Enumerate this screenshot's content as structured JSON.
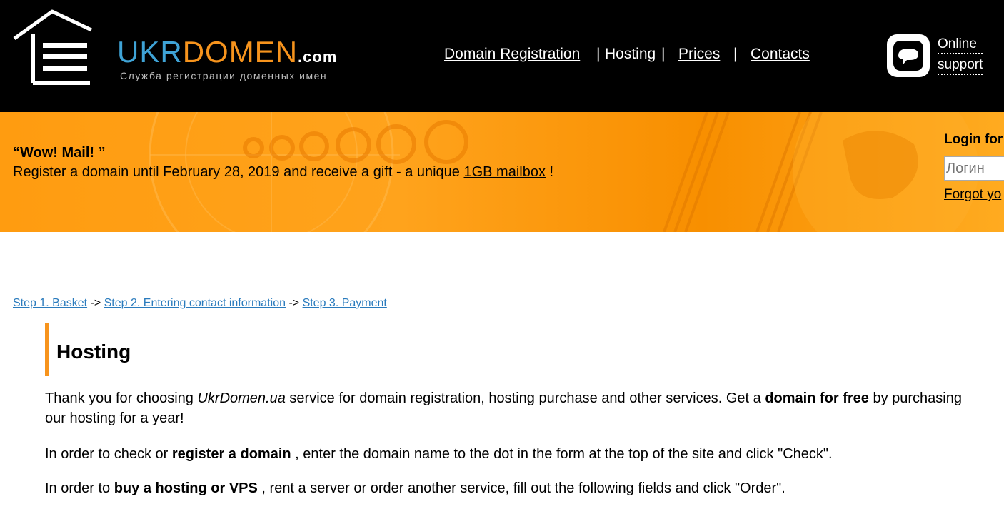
{
  "header": {
    "logo": {
      "ukr": "UKR",
      "domen": "DOMEN",
      "com": ".com",
      "tagline": "Служба регистрации доменных имен"
    },
    "nav": {
      "domain_registration": "Domain Registration",
      "sep1": "|",
      "hosting": "Hosting",
      "sep2": "|",
      "prices": "Prices",
      "sep3": "|",
      "contacts": "Contacts"
    },
    "support": {
      "line1": "Online",
      "line2": "support",
      "icon": "chat-bubble-icon"
    }
  },
  "banner": {
    "title": "“Wow! Mail! ”",
    "text_before": "Register a domain until February 28, 2019 and receive a gift - a unique ",
    "link": "1GB mailbox",
    "text_after": " !"
  },
  "login": {
    "title": "Login for",
    "placeholder": "Логин",
    "forgot": "Forgot yo"
  },
  "breadcrumb": {
    "step1": "Step 1. Basket",
    "arrow1": " -> ",
    "step2": "Step 2. Entering contact information",
    "arrow2": " -> ",
    "step3": "Step 3. Payment"
  },
  "content": {
    "title": "Hosting",
    "p1": {
      "a": "Thank you for choosing ",
      "b": "UkrDomen.ua",
      "c": " service for domain registration, hosting purchase and other services. Get a ",
      "d": "domain for free",
      "e": " by purchasing our hosting for a year!"
    },
    "p2": {
      "a": "In order to check or ",
      "b": "register a domain",
      "c": " , enter the domain name to the dot in the form at the top of the site and click \"Check\"."
    },
    "p3": {
      "a": "In order to ",
      "b": "buy a hosting or VPS",
      "c": " , rent a server or order another service, fill out the following fields and click \"Order\"."
    }
  },
  "colors": {
    "accent": "#f7941d",
    "brand_blue": "#3fa3d6",
    "link": "#2a7bbd",
    "header_bg": "#000000"
  }
}
